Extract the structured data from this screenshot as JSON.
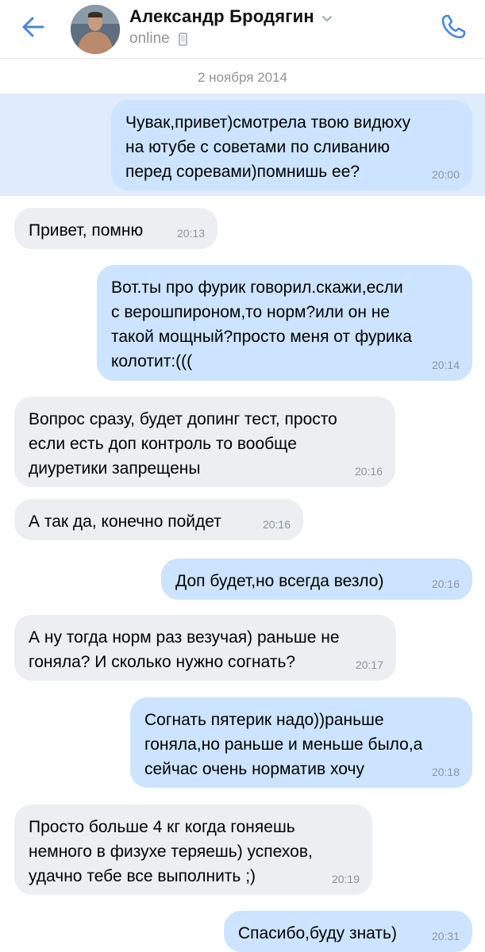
{
  "header": {
    "contact_name": "Александр Бродягин",
    "status": "online",
    "icons": {
      "back": "back-arrow-icon",
      "dropdown": "chevron-down-icon",
      "mobile": "mobile-phone-icon",
      "call": "phone-call-icon"
    }
  },
  "conversation": {
    "date_separator": "2 ноября 2014",
    "messages": [
      {
        "direction": "outgoing",
        "text": "Чувак,привет)смотрела твою видюху\nна ютубе с советами по сливанию\nперед соревами)помнишь ее?",
        "time": "20:00",
        "selected": true
      },
      {
        "direction": "incoming",
        "text": "Привет, помню",
        "time": "20:13"
      },
      {
        "direction": "outgoing",
        "text": "Вот.ты про фурик говорил.скажи,если\nс верошпироном,то норм?или он не\nтакой мощный?просто меня от фурика\nколотит:(((",
        "time": "20:14"
      },
      {
        "direction": "incoming",
        "text": "Вопрос сразу, будет допинг тест, просто\nесли есть доп контроль то вообще\nдиуретики запрещены",
        "time": "20:16"
      },
      {
        "direction": "incoming",
        "text": "А так да, конечно пойдет",
        "time": "20:16"
      },
      {
        "direction": "outgoing",
        "text": "Доп будет,но всегда везло)",
        "time": "20:16"
      },
      {
        "direction": "incoming",
        "text": "А ну тогда норм раз везучая) раньше не\nгоняла? И сколько нужно согнать?",
        "time": "20:17"
      },
      {
        "direction": "outgoing",
        "text": "Согнать пятерик надо))раньше\nгоняла,но раньше и меньше было,а\nсейчас очень норматив хочу",
        "time": "20:18"
      },
      {
        "direction": "incoming",
        "text": "Просто больше 4 кг когда гоняешь\nнемного в  физухе теряешь)  успехов,\nудачно тебе все выполнить ;)",
        "time": "20:19"
      },
      {
        "direction": "outgoing",
        "text": "Спасибо,буду знать)",
        "time": "20:31"
      }
    ]
  },
  "colors": {
    "accent": "#4a86d8",
    "incoming_bubble": "#eceef1",
    "outgoing_bubble": "#cce4ff",
    "selection": "#deecfb",
    "secondary_text": "#939393"
  }
}
